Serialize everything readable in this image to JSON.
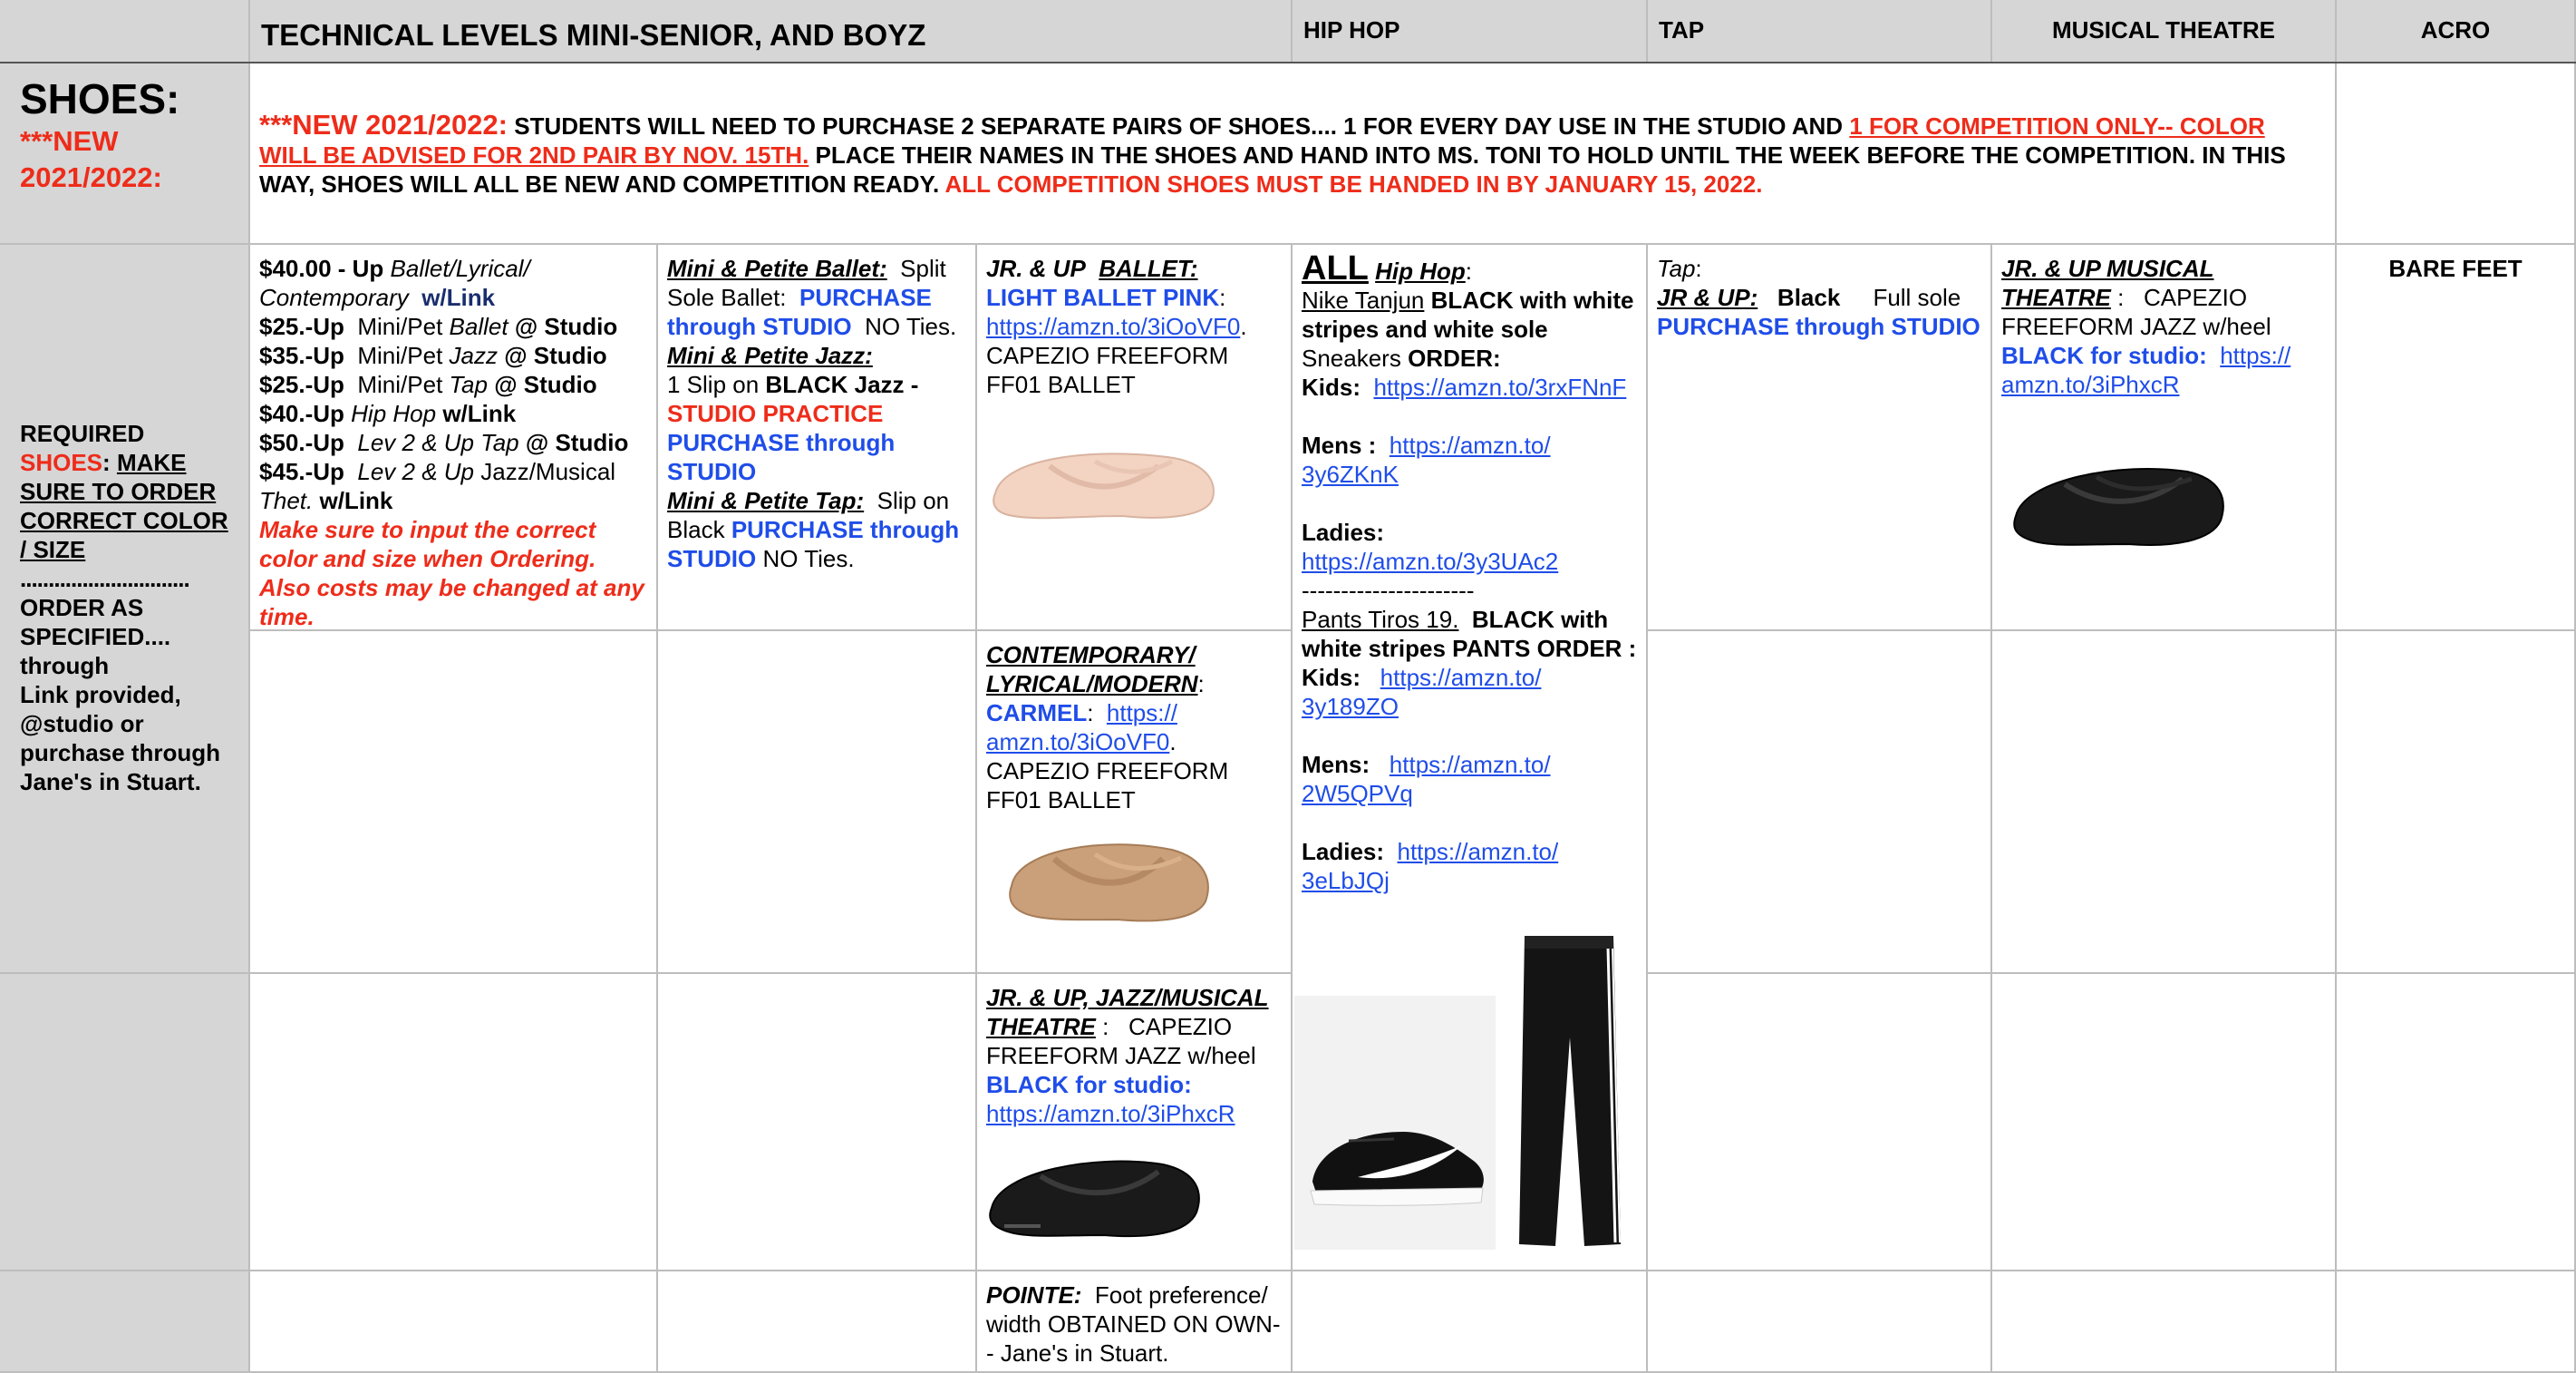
{
  "header": {
    "title": "TECHNICAL LEVELS MINI-SENIOR,  AND BOYZ",
    "hiphop": "HIP HOP",
    "tap": "TAP",
    "musical": "MUSICAL THEATRE",
    "acro": "ACRO"
  },
  "shoes_label": {
    "title": "SHOES:",
    "new": "***NEW 2021/2022:"
  },
  "notice": {
    "prefix": "***NEW 2021/2022:",
    "part1": "STUDENTS WILL NEED TO PURCHASE 2 SEPARATE PAIRS OF SHOES.... 1 FOR EVERY DAY USE IN THE STUDIO  AND",
    "link_red": "1 FOR COMPETITION ONLY-- COLOR WILL BE ADVISED FOR 2ND PAIR BY NOV. 15TH.",
    "part2": "PLACE THEIR NAMES IN THE SHOES AND HAND INTO MS. TONI TO HOLD UNTIL THE WEEK BEFORE THE COMPETITION.   IN THIS WAY, SHOES WILL ALL BE NEW AND COMPETITION READY.",
    "red_end": "ALL COMPETITION SHOES MUST BE  HANDED IN BY JANUARY 15, 2022."
  },
  "required": {
    "l1": "REQUIRED",
    "l2_red": "SHOES",
    "l2_colon": ":",
    "l2_u": "MAKE SURE TO ORDER CORRECT COLOR / SIZE",
    "dots": "..............................",
    "l3": "ORDER   AS SPECIFIED.... through",
    "l4": "Link provided, @studio or purchase through Jane's in Stuart."
  },
  "prices": {
    "r1a": "$40.00 - Up",
    "r1b": "Ballet/Lyrical/ Contemporary",
    "r1c": "w/Link",
    "r2a": "$25.-Up",
    "r2b": "Mini/Pet",
    "r2c": "Ballet",
    "r2d": "@ Studio",
    "r3a": "$35.-Up",
    "r3b": "Mini/Pet",
    "r3c": "Jazz",
    "r3d": "@ Studio",
    "r4a": "$25.-Up",
    "r4b": "Mini/Pet",
    "r4c": "Tap",
    "r4d": "@ Studio",
    "r5a": "$40.-Up",
    "r5b": "Hip Hop",
    "r5c": "w/Link",
    "r6a": "$50.-Up",
    "r6b": "Lev 2 & Up Tap",
    "r6c": "@ Studio",
    "r7a": "$45.-Up",
    "r7b": "Lev 2 & Up",
    "r7c": "Jazz/Musical",
    "r7d": "Thet.",
    "r7e": "w/Link",
    "warn": "Make sure to input the correct color and size when Ordering. Also costs may be changed at any time."
  },
  "mini": {
    "ballet_h": "Mini & Petite Ballet:",
    "ballet_t1": "Split Sole Ballet:",
    "ballet_blue": "PURCHASE through STUDIO",
    "ballet_t2": "NO Ties.",
    "jazz_h": "Mini & Petite Jazz:",
    "jazz_t1": "1 Slip on",
    "jazz_b": "BLACK Jazz -",
    "jazz_red": "STUDIO PRACTICE",
    "jazz_blue": "PURCHASE through STUDIO",
    "tap_h": "Mini & Petite Tap:",
    "tap_t1": "Slip on Black",
    "tap_blue": "PURCHASE through STUDIO",
    "tap_t2": "NO Ties."
  },
  "jr_ballet": {
    "h1": "JR. & UP",
    "h2": "BALLET:",
    "color": "LIGHT BALLET PINK",
    "link": "https://amzn.to/3iOoVF0",
    "desc": "CAPEZIO FREEFORM FF01 BALLET"
  },
  "contemporary": {
    "h": "CONTEMPORARY/ LYRICAL/MODERN",
    "color": "CARMEL",
    "link": "https:// amzn.to/3iOoVF0",
    "desc": "CAPEZIO FREEFORM FF01 BALLET"
  },
  "jr_jazz": {
    "h": "JR. & UP, JAZZ/MUSICAL THEATRE",
    "desc": "CAPEZIO FREEFORM JAZZ w/heel",
    "color": "BLACK for studio:",
    "link": "https://amzn.to/3iPhxcR"
  },
  "pointe": {
    "h": "POINTE:",
    "t": "Foot preference/ width OBTAINED ON OWN-- Jane's in Stuart."
  },
  "hiphop": {
    "all": "ALL",
    "hh": "Hip Hop",
    "colon": ":",
    "nike": "Nike Tanjun",
    "nike_b": "BLACK with white stripes and white sole",
    "sneakers": "Sneakers",
    "order": "ORDER:",
    "kids_l": "Kids:",
    "kids": "https://amzn.to/3rxFNnF",
    "mens_l": "Mens :",
    "mens": "https://amzn.to/ 3y6ZKnK",
    "ladies_l": "Ladies:",
    "ladies": "https://amzn.to/3y3UAc2",
    "dash": "----------------------",
    "pants": "Pants Tiros 19.",
    "pants_b": "BLACK with white stripes PANTS ORDER :",
    "pkids_l": "Kids:",
    "pkids": "https://amzn.to/ 3y189ZO",
    "pmens_l": "Mens:",
    "pmens": "https://amzn.to/ 2W5QPVq",
    "pladies_l": "Ladies:",
    "pladies": "https://amzn.to/ 3eLbJQj"
  },
  "tap": {
    "tap": "Tap",
    "colon": ":",
    "jr": "JR & UP:",
    "black": "Black",
    "full": "Full sole",
    "blue": "PURCHASE through STUDIO"
  },
  "musical": {
    "h": "JR. & UP MUSICAL THEATRE",
    "colon": ":",
    "desc": "CAPEZIO FREEFORM JAZZ w/heel",
    "color": "BLACK for studio:",
    "link": "https:// amzn.to/3iPhxcR"
  },
  "acro": {
    "text": "BARE FEET"
  },
  "colors": {
    "red": "#ee2c1a",
    "blue": "#1f4de8",
    "gray": "#d6d6d6"
  }
}
